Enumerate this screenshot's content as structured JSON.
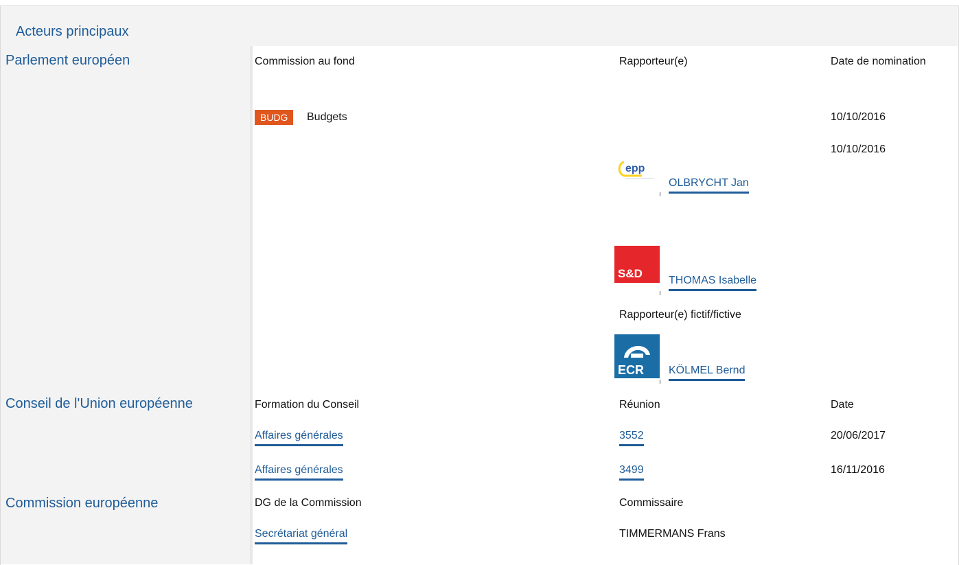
{
  "section_title": "Acteurs principaux",
  "parliament": {
    "institution": "Parlement européen",
    "col_committee": "Commission au fond",
    "col_rapporteur": "Rapporteur(e)",
    "col_date": "Date de nomination",
    "committee_badge": "BUDG",
    "committee_name": "Budgets",
    "committee_date": "10/10/2016",
    "rapporteur_date": "10/10/2016",
    "rapporteurs": [
      {
        "group_logo": "EPP",
        "name": "OLBRYCHT Jan"
      },
      {
        "group_logo": "S&D",
        "name": "THOMAS Isabelle"
      }
    ],
    "shadow_label": "Rapporteur(e) fictif/fictive",
    "shadows": [
      {
        "group_logo": "ECR",
        "name": "KÖLMEL Bernd"
      }
    ]
  },
  "council": {
    "institution": "Conseil de l'Union européenne",
    "col_formation": "Formation du Conseil",
    "col_meeting": "Réunion",
    "col_date": "Date",
    "rows": [
      {
        "formation": "Affaires générales",
        "meeting": "3552",
        "date": "20/06/2017"
      },
      {
        "formation": "Affaires générales",
        "meeting": "3499",
        "date": "16/11/2016"
      }
    ]
  },
  "commission": {
    "institution": "Commission européenne",
    "col_dg": "DG de la Commission",
    "col_commissioner": "Commissaire",
    "dg": "Secrétariat général",
    "commissioner": "TIMMERMANS Frans"
  }
}
